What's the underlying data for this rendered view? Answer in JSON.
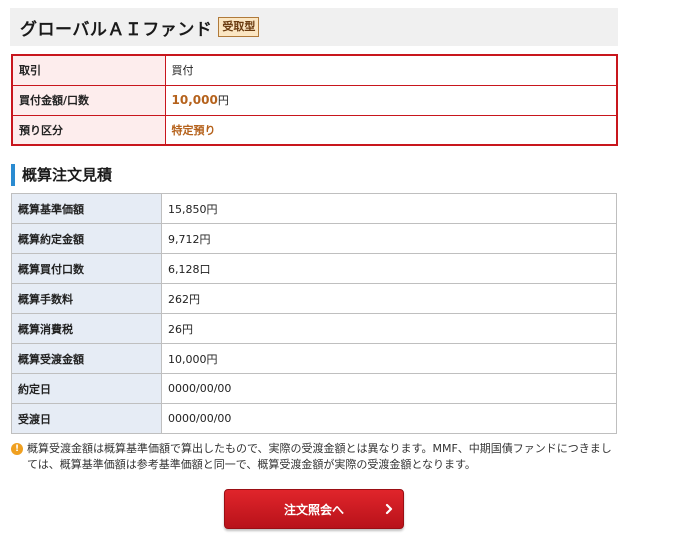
{
  "fund": {
    "title": "グローバルＡＩファンド",
    "badge": "受取型"
  },
  "order": {
    "rows": [
      {
        "label": "取引",
        "value": "買付"
      },
      {
        "label": "買付金額/口数",
        "amount": "10,000",
        "unit": "円"
      },
      {
        "label": "預り区分",
        "value": "特定預り"
      }
    ]
  },
  "estimate": {
    "title": "概算注文見積",
    "rows": [
      {
        "label": "概算基準価額",
        "value": "15,850円"
      },
      {
        "label": "概算約定金額",
        "value": "9,712円"
      },
      {
        "label": "概算買付口数",
        "value": "6,128口"
      },
      {
        "label": "概算手数料",
        "value": "262円"
      },
      {
        "label": "概算消費税",
        "value": "26円"
      },
      {
        "label": "概算受渡金額",
        "value": "10,000円"
      },
      {
        "label": "約定日",
        "value": "0000/00/00"
      },
      {
        "label": "受渡日",
        "value": "0000/00/00"
      }
    ]
  },
  "note": {
    "text": "概算受渡金額は概算基準価額で算出したもので、実際の受渡金額とは異なります。MMF、中期国債ファンドにつきましては、概算基準価額は参考基準価額と同一で、概算受渡金額が実際の受渡金額となります。"
  },
  "button": {
    "label": "注文照会へ"
  },
  "colors": {
    "accent_red": "#c8161d",
    "section_blue": "#2a8bd1",
    "value_orange": "#b5621c",
    "note_icon": "#f0a020"
  },
  "icons": {
    "note": "info-circle-icon",
    "button": "chevron-right-icon"
  }
}
